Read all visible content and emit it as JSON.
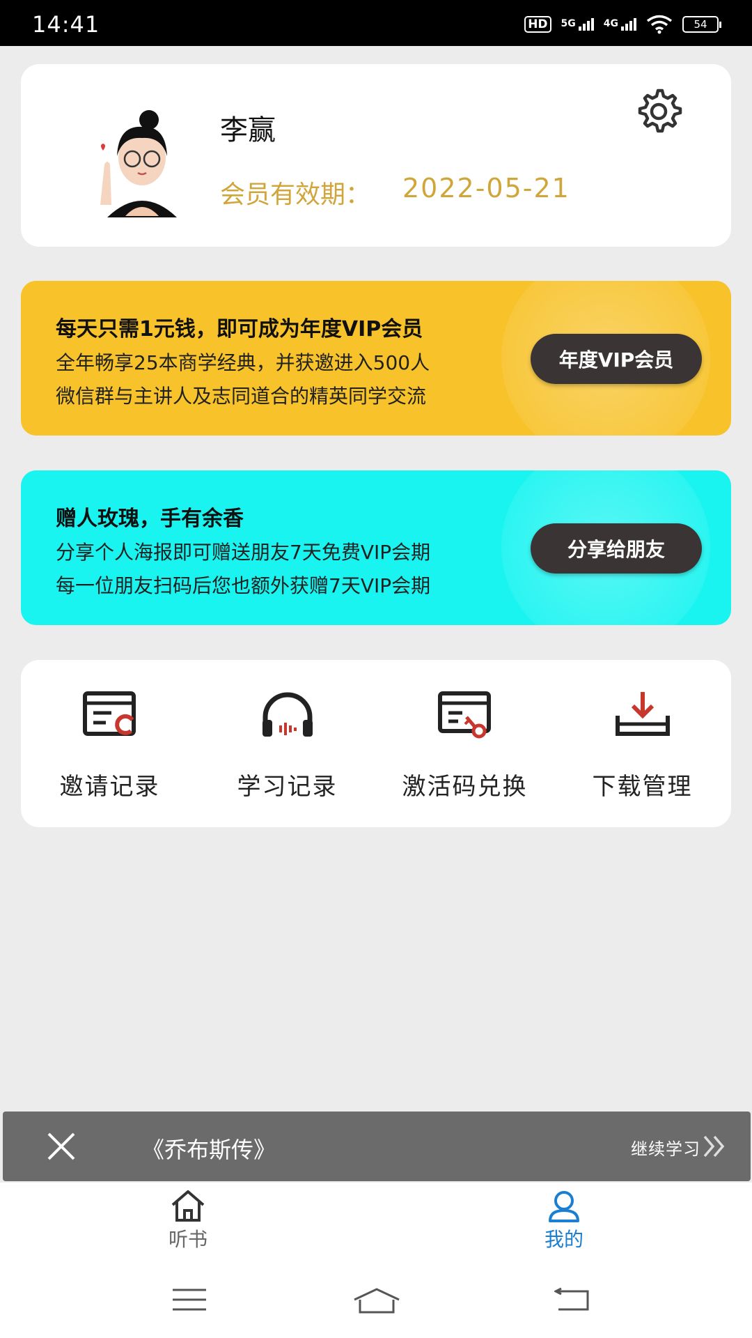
{
  "status_bar": {
    "time": "14:41",
    "hd": "HD",
    "net1": "5G",
    "net2": "4G",
    "battery": "54"
  },
  "profile": {
    "name": "李赢",
    "vip_label": "会员有效期：",
    "vip_date": "2022-05-21"
  },
  "banners": [
    {
      "title": "每天只需1元钱，即可成为年度VIP会员",
      "line1": "全年畅享25本商学经典，并获邀进入500人",
      "line2": "微信群与主讲人及志同道合的精英同学交流",
      "button": "年度VIP会员",
      "color": "#f7c22a"
    },
    {
      "title": "赠人玫瑰，手有余香",
      "line1": "分享个人海报即可赠送朋友7天免费VIP会期",
      "line2": "每一位朋友扫码后您也额外获赠7天VIP会期",
      "button": "分享给朋友",
      "color": "#19f4f0"
    }
  ],
  "grid": [
    {
      "label": "邀请记录",
      "icon": "invite-record-icon"
    },
    {
      "label": "学习记录",
      "icon": "headphones-icon"
    },
    {
      "label": "激活码兑换",
      "icon": "activation-code-icon"
    },
    {
      "label": "下载管理",
      "icon": "download-icon"
    }
  ],
  "mini_player": {
    "book": "《乔布斯传》",
    "continue": "继续学习"
  },
  "bottom_nav": [
    {
      "label": "听书",
      "icon": "home-icon",
      "active": false
    },
    {
      "label": "我的",
      "icon": "user-icon",
      "active": true
    }
  ],
  "colors": {
    "accent_gold": "#d0a63b",
    "active_blue": "#1a7fd0",
    "icon_red": "#c8372d"
  }
}
